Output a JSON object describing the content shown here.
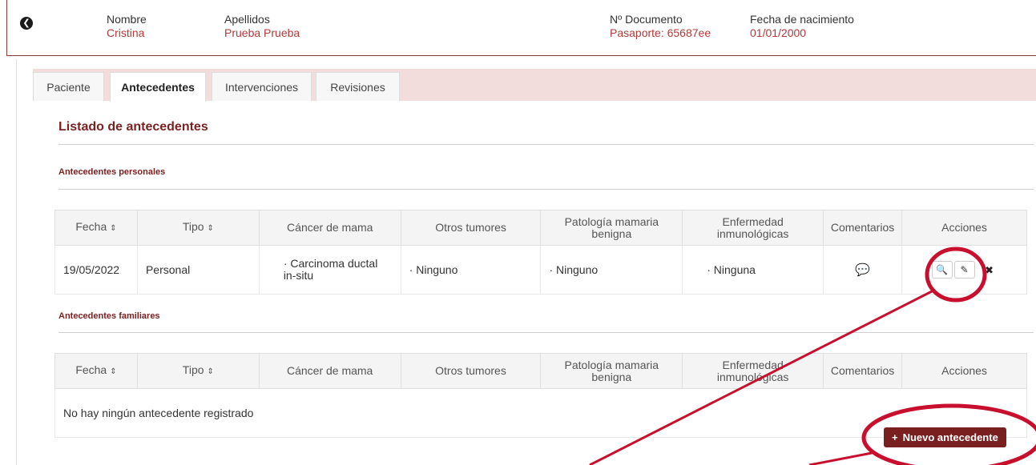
{
  "patient": {
    "nombre_label": "Nombre",
    "nombre": "Cristina",
    "apellidos_label": "Apellidos",
    "apellidos": "Prueba Prueba",
    "documento_label": "Nº Documento",
    "documento": "Pasaporte: 65687ee",
    "fecha_label": "Fecha de nacimiento",
    "fecha": "01/01/2000"
  },
  "tabs": [
    "Paciente",
    "Antecedentes",
    "Intervenciones",
    "Revisiones"
  ],
  "page_title": "Listado de antecedentes",
  "sections": {
    "personales": "Antecedentes personales",
    "familiares": "Antecedentes familiares"
  },
  "columns": [
    "Fecha",
    "Tipo",
    "Cáncer de mama",
    "Otros tumores",
    "Patología mamaria benigna",
    "Enfermedad inmunológicas",
    "Comentarios",
    "Acciones"
  ],
  "personal_rows": [
    {
      "fecha": "19/05/2022",
      "tipo": "Personal",
      "cancer": "· Carcinoma ductal in-situ",
      "otros": "· Ninguno",
      "patologia": "· Ninguno",
      "enfermedad": "· Ninguna"
    }
  ],
  "familiar_empty": "No hay ningún antecedente registrado",
  "new_button": "Nuevo antecedente",
  "icons": {
    "back": "chevron-left-icon",
    "sort": "sort-icon",
    "comment": "comment-icon",
    "view": "search-icon",
    "edit": "edit-icon",
    "delete": "close-icon",
    "add": "plus-icon"
  },
  "colors": {
    "accent": "#7a1f1f",
    "value_text": "#b03a3a",
    "annotation": "#c8102e",
    "tab_strip": "#f2dcdc"
  }
}
